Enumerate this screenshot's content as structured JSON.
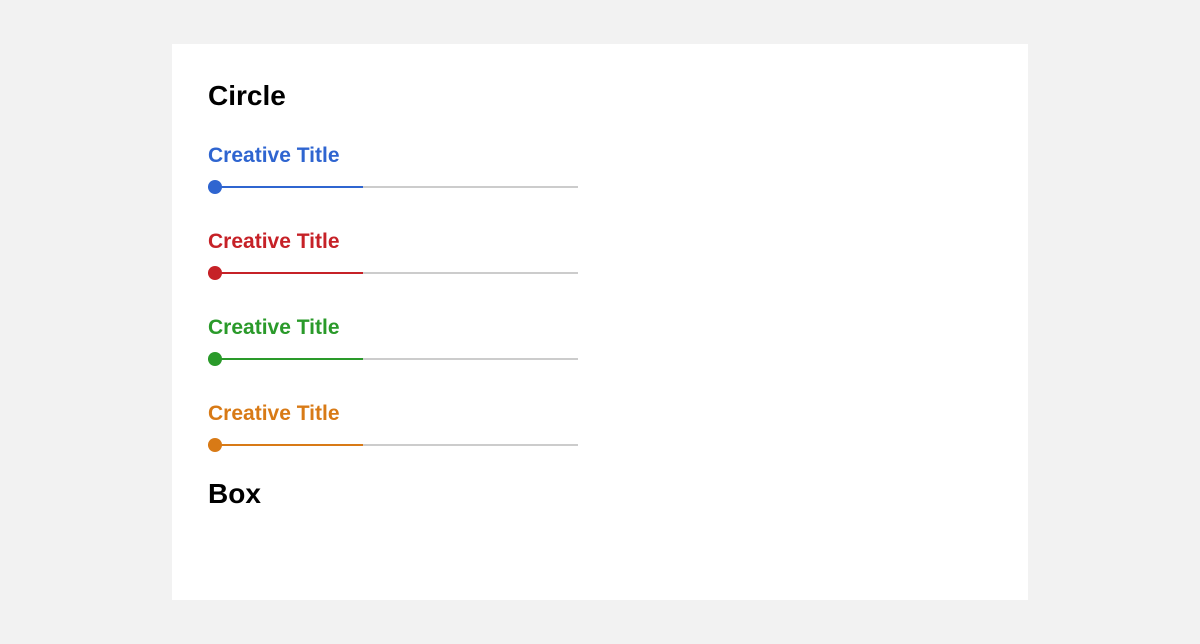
{
  "headings": {
    "circle": "Circle",
    "box": "Box"
  },
  "items": [
    {
      "label": "Creative Title",
      "color": "blue",
      "fill_pct": 42
    },
    {
      "label": "Creative Title",
      "color": "red",
      "fill_pct": 42
    },
    {
      "label": "Creative Title",
      "color": "green",
      "fill_pct": 42
    },
    {
      "label": "Creative Title",
      "color": "orange",
      "fill_pct": 42
    }
  ]
}
